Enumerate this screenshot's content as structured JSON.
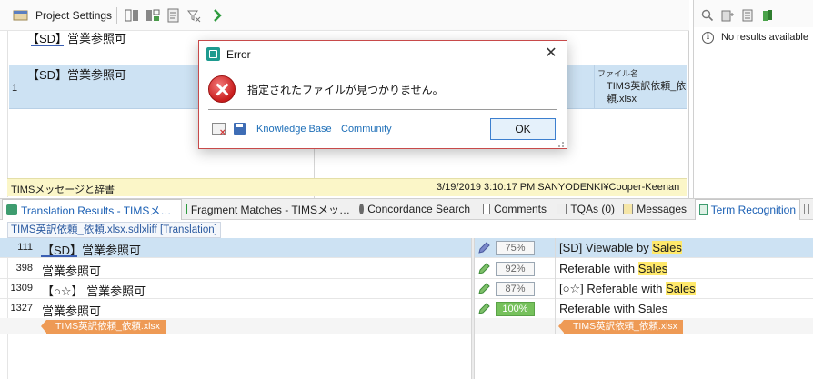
{
  "toolbar": {
    "project_settings_label": "Project Settings"
  },
  "editor_top": {
    "header_text": "【SD】営業参照可",
    "row_number": "1",
    "row_source": "【SD】営業参照可",
    "file_name_label": "ファイル名",
    "file_name_value": "TIMS英訳依頼_依頼.xlsx"
  },
  "status_bar": {
    "left": "TIMSメッセージと辞書",
    "right": "3/19/2019 3:10:17 PM  SANYODENKI¥Cooper-Keenan"
  },
  "right_panel": {
    "message": "No results available"
  },
  "tabs": [
    {
      "label": "Translation Results - TIMSメ…"
    },
    {
      "label": "Fragment Matches - TIMSメッ…"
    },
    {
      "label": "Concordance Search"
    },
    {
      "label": "Comments"
    },
    {
      "label": "TQAs (0)"
    },
    {
      "label": "Messages"
    },
    {
      "label": "Term Recognition"
    }
  ],
  "document": {
    "label": "TIMS英訳依頼_依頼.xlsx.sdlxliff [Translation]"
  },
  "segments": [
    {
      "num": "111",
      "source": "【SD】営業参照可",
      "score": "75%",
      "target_prefix": "[SD] Viewable by ",
      "target_highlight": "Sales"
    },
    {
      "num": "398",
      "source": "営業参照可",
      "score": "92%",
      "target_prefix": "Referable with ",
      "target_highlight": "Sales"
    },
    {
      "num": "1309",
      "source": "【○☆】 営業参照可",
      "score": "87%",
      "target_prefix": "[○☆] Referable with ",
      "target_highlight": "Sales"
    },
    {
      "num": "1327",
      "source": "営業参照可",
      "score": "100%",
      "target_prefix": "Referable with Sales",
      "target_highlight": ""
    }
  ],
  "file_tags": {
    "source": "TIMS英訳依頼_依頼.xlsx",
    "target": "TIMS英訳依頼_依頼.xlsx"
  },
  "dialog": {
    "title": "Error",
    "close_glyph": "✕",
    "message": "指定されたファイルが見つかりません。",
    "knowledge_base": "Knowledge Base",
    "community": "Community",
    "ok": "OK"
  },
  "colors": {
    "selection": "#cde2f3",
    "status_bg": "#fbf6c8",
    "file_tag": "#ee9a55",
    "match_full": "#76c15c",
    "dialog_border": "#c84a4a",
    "link": "#1e6fb8"
  }
}
